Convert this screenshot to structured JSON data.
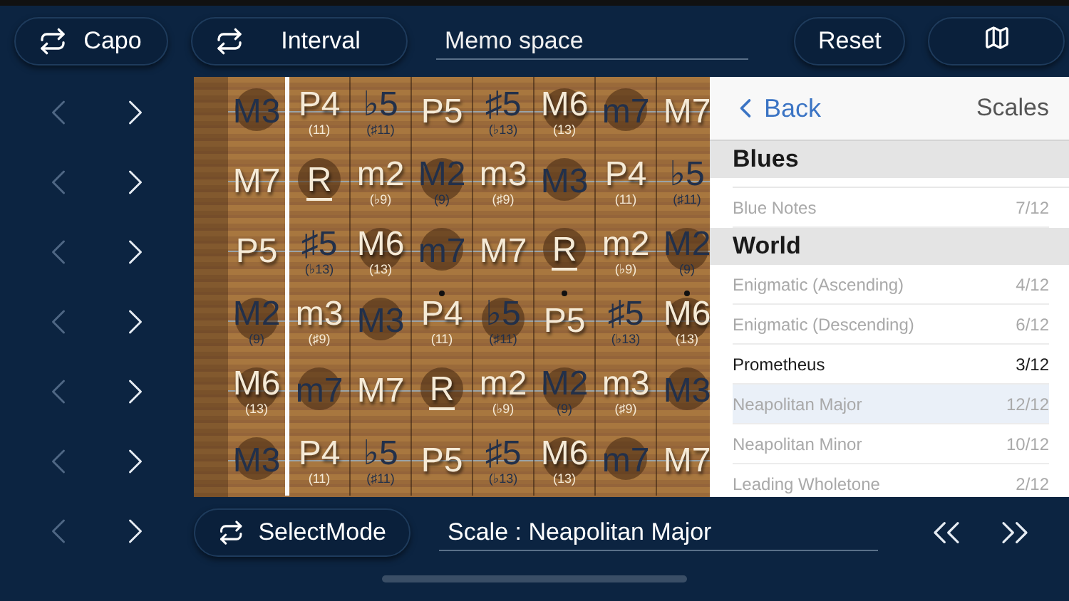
{
  "toolbar": {
    "toggles": [
      {
        "label": "Capo"
      },
      {
        "label": "Interval"
      }
    ],
    "memo": {
      "placeholder": "Memo space"
    },
    "reset": "Reset"
  },
  "string_nav": [
    {
      "back_enabled": false,
      "forward_enabled": true
    },
    {
      "back_enabled": false,
      "forward_enabled": true
    },
    {
      "back_enabled": false,
      "forward_enabled": true
    },
    {
      "back_enabled": false,
      "forward_enabled": true
    },
    {
      "back_enabled": false,
      "forward_enabled": true
    },
    {
      "back_enabled": false,
      "forward_enabled": true
    },
    {
      "back_enabled": false,
      "forward_enabled": true
    }
  ],
  "fretboard": {
    "strings": [
      {
        "cells": [
          {
            "note": "M3",
            "in_scale": false,
            "circle": true,
            "root": false,
            "dot": false
          },
          {
            "note": "P4",
            "sub": "(11)",
            "in_scale": true,
            "circle": false,
            "root": false,
            "dot": false
          },
          {
            "note": "♭5",
            "sub": "(♯11)",
            "in_scale": false,
            "circle": false,
            "root": false,
            "dot": false
          },
          {
            "note": "P5",
            "in_scale": true,
            "circle": false,
            "root": false,
            "dot": false
          },
          {
            "note": "♯5",
            "sub": "(♭13)",
            "in_scale": false,
            "circle": false,
            "root": false,
            "dot": false
          },
          {
            "note": "M6",
            "sub": "(13)",
            "in_scale": true,
            "circle": true,
            "root": false,
            "dot": false
          },
          {
            "note": "m7",
            "in_scale": false,
            "circle": true,
            "root": false,
            "dot": false
          },
          {
            "note": "M7",
            "in_scale": true,
            "circle": false,
            "root": false,
            "dot": false
          }
        ]
      },
      {
        "cells": [
          {
            "note": "M7",
            "in_scale": true,
            "circle": false,
            "root": false,
            "dot": false
          },
          {
            "note": "R",
            "in_scale": true,
            "circle": true,
            "root": true,
            "dot": false
          },
          {
            "note": "m2",
            "sub": "(♭9)",
            "in_scale": true,
            "circle": false,
            "root": false,
            "dot": false
          },
          {
            "note": "M2",
            "sub": "(9)",
            "in_scale": false,
            "circle": true,
            "root": false,
            "dot": false
          },
          {
            "note": "m3",
            "sub": "(♯9)",
            "in_scale": true,
            "circle": false,
            "root": false,
            "dot": false
          },
          {
            "note": "M3",
            "in_scale": false,
            "circle": true,
            "root": false,
            "dot": false
          },
          {
            "note": "P4",
            "sub": "(11)",
            "in_scale": true,
            "circle": false,
            "root": false,
            "dot": false
          },
          {
            "note": "♭5",
            "sub": "(♯11)",
            "in_scale": false,
            "circle": false,
            "root": false,
            "dot": false
          }
        ]
      },
      {
        "cells": [
          {
            "note": "P5",
            "in_scale": true,
            "circle": false,
            "root": false,
            "dot": false
          },
          {
            "note": "♯5",
            "sub": "(♭13)",
            "in_scale": false,
            "circle": false,
            "root": false,
            "dot": false
          },
          {
            "note": "M6",
            "sub": "(13)",
            "in_scale": true,
            "circle": true,
            "root": false,
            "dot": false
          },
          {
            "note": "m7",
            "in_scale": false,
            "circle": true,
            "root": false,
            "dot": false
          },
          {
            "note": "M7",
            "in_scale": true,
            "circle": false,
            "root": false,
            "dot": false
          },
          {
            "note": "R",
            "in_scale": true,
            "circle": true,
            "root": true,
            "dot": false
          },
          {
            "note": "m2",
            "sub": "(♭9)",
            "in_scale": true,
            "circle": false,
            "root": false,
            "dot": false
          },
          {
            "note": "M2",
            "sub": "(9)",
            "in_scale": false,
            "circle": true,
            "root": false,
            "dot": false
          }
        ]
      },
      {
        "cells": [
          {
            "note": "M2",
            "sub": "(9)",
            "in_scale": false,
            "circle": true,
            "root": false,
            "dot": false
          },
          {
            "note": "m3",
            "sub": "(♯9)",
            "in_scale": true,
            "circle": false,
            "root": false,
            "dot": false
          },
          {
            "note": "M3",
            "in_scale": false,
            "circle": true,
            "root": false,
            "dot": false
          },
          {
            "note": "P4",
            "sub": "(11)",
            "in_scale": true,
            "circle": false,
            "root": false,
            "dot": true
          },
          {
            "note": "♭5",
            "sub": "(♯11)",
            "in_scale": false,
            "circle": true,
            "root": false,
            "dot": false
          },
          {
            "note": "P5",
            "in_scale": true,
            "circle": false,
            "root": false,
            "dot": true
          },
          {
            "note": "♯5",
            "sub": "(♭13)",
            "in_scale": false,
            "circle": false,
            "root": false,
            "dot": false
          },
          {
            "note": "M6",
            "sub": "(13)",
            "in_scale": true,
            "circle": true,
            "root": false,
            "dot": true
          }
        ]
      },
      {
        "cells": [
          {
            "note": "M6",
            "sub": "(13)",
            "in_scale": true,
            "circle": true,
            "root": false,
            "dot": false
          },
          {
            "note": "m7",
            "in_scale": false,
            "circle": true,
            "root": false,
            "dot": false
          },
          {
            "note": "M7",
            "in_scale": true,
            "circle": false,
            "root": false,
            "dot": false
          },
          {
            "note": "R",
            "in_scale": true,
            "circle": true,
            "root": true,
            "dot": false
          },
          {
            "note": "m2",
            "sub": "(♭9)",
            "in_scale": true,
            "circle": false,
            "root": false,
            "dot": false
          },
          {
            "note": "M2",
            "sub": "(9)",
            "in_scale": false,
            "circle": true,
            "root": false,
            "dot": false
          },
          {
            "note": "m3",
            "sub": "(♯9)",
            "in_scale": true,
            "circle": false,
            "root": false,
            "dot": false
          },
          {
            "note": "M3",
            "in_scale": false,
            "circle": true,
            "root": false,
            "dot": false
          }
        ]
      },
      {
        "cells": [
          {
            "note": "M3",
            "in_scale": false,
            "circle": true,
            "root": false,
            "dot": false
          },
          {
            "note": "P4",
            "sub": "(11)",
            "in_scale": true,
            "circle": false,
            "root": false,
            "dot": false
          },
          {
            "note": "♭5",
            "sub": "(♯11)",
            "in_scale": false,
            "circle": false,
            "root": false,
            "dot": false
          },
          {
            "note": "P5",
            "in_scale": true,
            "circle": false,
            "root": false,
            "dot": false
          },
          {
            "note": "♯5",
            "sub": "(♭13)",
            "in_scale": false,
            "circle": false,
            "root": false,
            "dot": false
          },
          {
            "note": "M6",
            "sub": "(13)",
            "in_scale": true,
            "circle": true,
            "root": false,
            "dot": false
          },
          {
            "note": "m7",
            "in_scale": false,
            "circle": true,
            "root": false,
            "dot": false
          },
          {
            "note": "M7",
            "in_scale": true,
            "circle": false,
            "root": false,
            "dot": false
          }
        ]
      }
    ]
  },
  "scales_panel": {
    "back": "Back",
    "title": "Scales",
    "sections": [
      {
        "title": "Blues",
        "rows": [
          {
            "name": "Blue Notes",
            "count": "7/12",
            "dimmed": true,
            "selected": false
          }
        ]
      },
      {
        "title": "World",
        "rows": [
          {
            "name": "Enigmatic (Ascending)",
            "count": "4/12",
            "dimmed": true,
            "selected": false
          },
          {
            "name": "Enigmatic (Descending)",
            "count": "6/12",
            "dimmed": true,
            "selected": false
          },
          {
            "name": "Prometheus",
            "count": "3/12",
            "dimmed": false,
            "selected": false
          },
          {
            "name": "Neapolitan Major",
            "count": "12/12",
            "dimmed": true,
            "selected": true
          },
          {
            "name": "Neapolitan Minor",
            "count": "10/12",
            "dimmed": true,
            "selected": false
          },
          {
            "name": "Leading Wholetone",
            "count": "2/12",
            "dimmed": true,
            "selected": false
          }
        ]
      }
    ]
  },
  "bottom": {
    "mode_button": "SelectMode",
    "scale_field": "Scale : Neapolitan Major"
  }
}
